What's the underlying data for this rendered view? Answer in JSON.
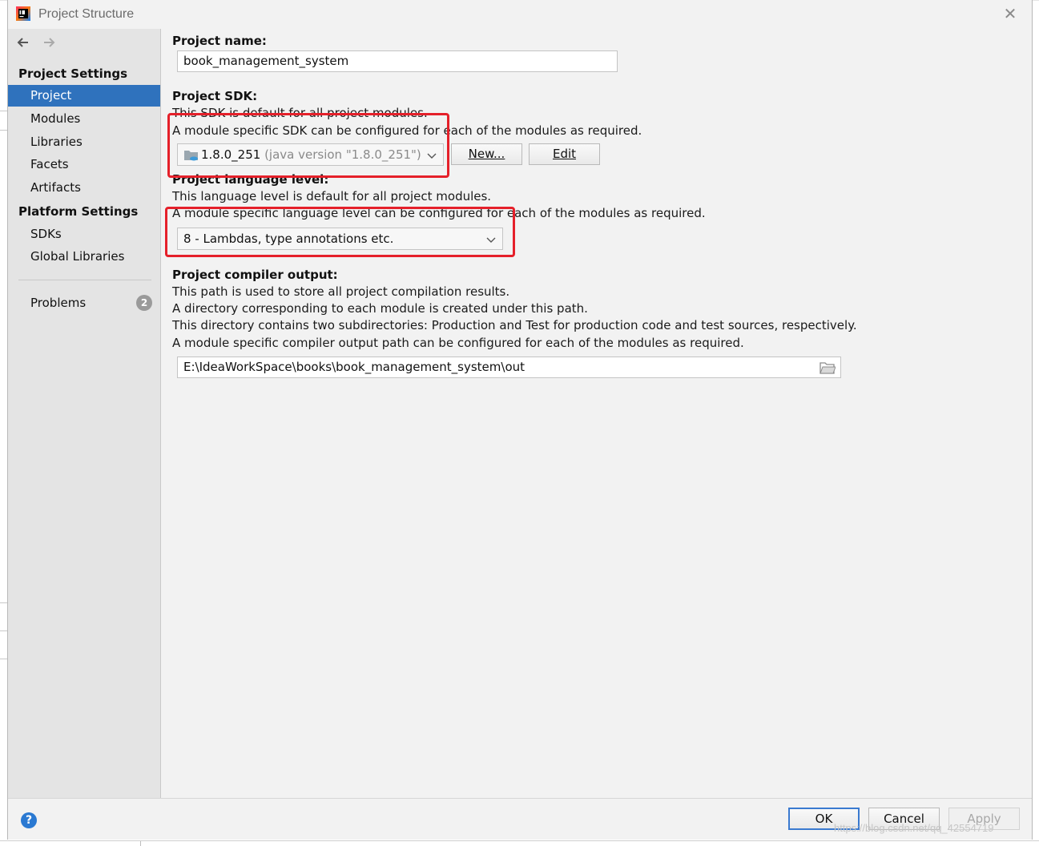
{
  "window": {
    "title": "Project Structure",
    "close_icon": "close-icon"
  },
  "sidebar": {
    "back_icon": "arrow-left-icon",
    "forward_icon": "arrow-right-icon",
    "project_settings_header": "Project Settings",
    "project_settings_items": [
      {
        "label": "Project",
        "selected": true
      },
      {
        "label": "Modules",
        "selected": false
      },
      {
        "label": "Libraries",
        "selected": false
      },
      {
        "label": "Facets",
        "selected": false
      },
      {
        "label": "Artifacts",
        "selected": false
      }
    ],
    "platform_settings_header": "Platform Settings",
    "platform_settings_items": [
      {
        "label": "SDKs"
      },
      {
        "label": "Global Libraries"
      }
    ],
    "problems": {
      "label": "Problems",
      "count": "2"
    }
  },
  "project_name": {
    "label": "Project name:",
    "value": "book_management_system"
  },
  "project_sdk": {
    "label": "Project SDK:",
    "desc1": "This SDK is default for all project modules.",
    "desc2": "A module specific SDK can be configured for each of the modules as required.",
    "selected_version": "1.8.0_251",
    "selected_detail": "(java version \"1.8.0_251\")",
    "new_button": "New...",
    "edit_button": "Edit"
  },
  "language_level": {
    "label": "Project language level:",
    "desc1": "This language level is default for all project modules.",
    "desc2": "A module specific language level can be configured for each of the modules as required.",
    "selected": "8 - Lambdas, type annotations etc."
  },
  "compiler_output": {
    "label": "Project compiler output:",
    "desc1": "This path is used to store all project compilation results.",
    "desc2": "A directory corresponding to each module is created under this path.",
    "desc3": "This directory contains two subdirectories: Production and Test for production code and test sources, respectively.",
    "desc4": "A module specific compiler output path can be configured for each of the modules as required.",
    "path": "E:\\IdeaWorkSpace\\books\\book_management_system\\out",
    "folder_icon": "folder-icon"
  },
  "footer": {
    "help_label": "?",
    "ok": "OK",
    "cancel": "Cancel",
    "apply": "Apply",
    "watermark": "https://blog.csdn.net/qq_42554719"
  },
  "colors": {
    "accent": "#2f72bd",
    "highlight_box": "#e5202a",
    "dialog_bg": "#f2f2f2",
    "sidebar_bg": "#e4e4e4"
  }
}
